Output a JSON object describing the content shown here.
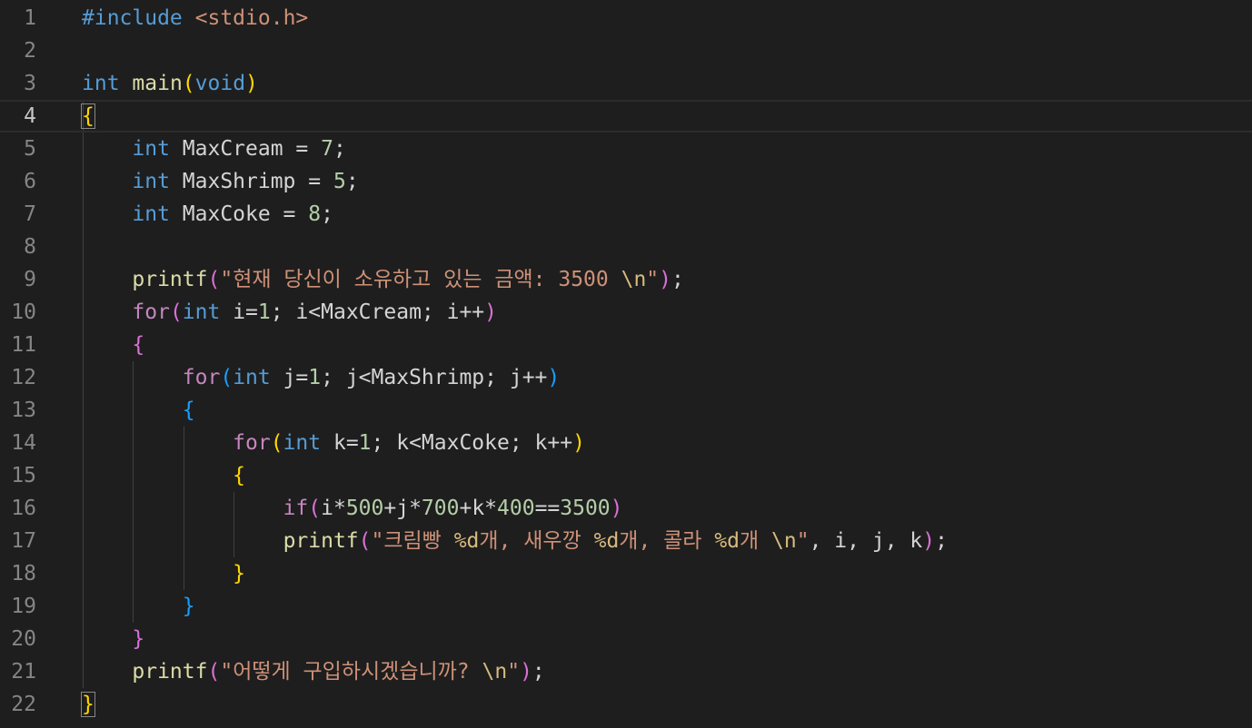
{
  "editor": {
    "language": "c",
    "theme_colors": {
      "background": "#1e1e1e",
      "keyword": "#569cd6",
      "control": "#c586c0",
      "function": "#dcdcaa",
      "string": "#ce9178",
      "number": "#b5cea8",
      "bracket_level1": "#ffd700",
      "bracket_level2": "#da70d6",
      "bracket_level3": "#179fff"
    },
    "active_line": 4,
    "lines": [
      {
        "num": "1",
        "tokens": [
          {
            "t": "#include",
            "c": "inc"
          },
          {
            "t": " ",
            "c": "plain"
          },
          {
            "t": "<stdio.h>",
            "c": "str"
          }
        ]
      },
      {
        "num": "2",
        "tokens": []
      },
      {
        "num": "3",
        "tokens": [
          {
            "t": "int",
            "c": "kw"
          },
          {
            "t": " ",
            "c": "plain"
          },
          {
            "t": "main",
            "c": "fn"
          },
          {
            "t": "(",
            "c": "b1"
          },
          {
            "t": "void",
            "c": "kw"
          },
          {
            "t": ")",
            "c": "b1"
          }
        ]
      },
      {
        "num": "4",
        "tokens": [
          {
            "t": "{",
            "c": "b1",
            "match": true
          }
        ]
      },
      {
        "num": "5",
        "tokens": [
          {
            "t": "    ",
            "c": "plain"
          },
          {
            "t": "int",
            "c": "kw"
          },
          {
            "t": " MaxCream = ",
            "c": "plain"
          },
          {
            "t": "7",
            "c": "num"
          },
          {
            "t": ";",
            "c": "plain"
          }
        ]
      },
      {
        "num": "6",
        "tokens": [
          {
            "t": "    ",
            "c": "plain"
          },
          {
            "t": "int",
            "c": "kw"
          },
          {
            "t": " MaxShrimp = ",
            "c": "plain"
          },
          {
            "t": "5",
            "c": "num"
          },
          {
            "t": ";",
            "c": "plain"
          }
        ]
      },
      {
        "num": "7",
        "tokens": [
          {
            "t": "    ",
            "c": "plain"
          },
          {
            "t": "int",
            "c": "kw"
          },
          {
            "t": " MaxCoke = ",
            "c": "plain"
          },
          {
            "t": "8",
            "c": "num"
          },
          {
            "t": ";",
            "c": "plain"
          }
        ]
      },
      {
        "num": "8",
        "tokens": []
      },
      {
        "num": "9",
        "tokens": [
          {
            "t": "    ",
            "c": "plain"
          },
          {
            "t": "printf",
            "c": "fn"
          },
          {
            "t": "(",
            "c": "b2"
          },
          {
            "t": "\"현재 당신이 소유하고 있는 금액: 3500 ",
            "c": "str"
          },
          {
            "t": "\\n",
            "c": "esc"
          },
          {
            "t": "\"",
            "c": "str"
          },
          {
            "t": ")",
            "c": "b2"
          },
          {
            "t": ";",
            "c": "plain"
          }
        ]
      },
      {
        "num": "10",
        "tokens": [
          {
            "t": "    ",
            "c": "plain"
          },
          {
            "t": "for",
            "c": "ctl"
          },
          {
            "t": "(",
            "c": "b2"
          },
          {
            "t": "int",
            "c": "kw"
          },
          {
            "t": " i=",
            "c": "plain"
          },
          {
            "t": "1",
            "c": "num"
          },
          {
            "t": "; i<MaxCream; i++",
            "c": "plain"
          },
          {
            "t": ")",
            "c": "b2"
          }
        ]
      },
      {
        "num": "11",
        "tokens": [
          {
            "t": "    ",
            "c": "plain"
          },
          {
            "t": "{",
            "c": "b2"
          }
        ]
      },
      {
        "num": "12",
        "tokens": [
          {
            "t": "        ",
            "c": "plain"
          },
          {
            "t": "for",
            "c": "ctl"
          },
          {
            "t": "(",
            "c": "b3"
          },
          {
            "t": "int",
            "c": "kw"
          },
          {
            "t": " j=",
            "c": "plain"
          },
          {
            "t": "1",
            "c": "num"
          },
          {
            "t": "; j<MaxShrimp; j++",
            "c": "plain"
          },
          {
            "t": ")",
            "c": "b3"
          }
        ]
      },
      {
        "num": "13",
        "tokens": [
          {
            "t": "        ",
            "c": "plain"
          },
          {
            "t": "{",
            "c": "b3"
          }
        ]
      },
      {
        "num": "14",
        "tokens": [
          {
            "t": "            ",
            "c": "plain"
          },
          {
            "t": "for",
            "c": "ctl"
          },
          {
            "t": "(",
            "c": "b1"
          },
          {
            "t": "int",
            "c": "kw"
          },
          {
            "t": " k=",
            "c": "plain"
          },
          {
            "t": "1",
            "c": "num"
          },
          {
            "t": "; k<MaxCoke; k++",
            "c": "plain"
          },
          {
            "t": ")",
            "c": "b1"
          }
        ]
      },
      {
        "num": "15",
        "tokens": [
          {
            "t": "            ",
            "c": "plain"
          },
          {
            "t": "{",
            "c": "b1"
          }
        ]
      },
      {
        "num": "16",
        "tokens": [
          {
            "t": "                ",
            "c": "plain"
          },
          {
            "t": "if",
            "c": "ctl"
          },
          {
            "t": "(",
            "c": "b2"
          },
          {
            "t": "i*",
            "c": "plain"
          },
          {
            "t": "500",
            "c": "num"
          },
          {
            "t": "+j*",
            "c": "plain"
          },
          {
            "t": "700",
            "c": "num"
          },
          {
            "t": "+k*",
            "c": "plain"
          },
          {
            "t": "400",
            "c": "num"
          },
          {
            "t": "==",
            "c": "plain"
          },
          {
            "t": "3500",
            "c": "num"
          },
          {
            "t": ")",
            "c": "b2"
          }
        ]
      },
      {
        "num": "17",
        "tokens": [
          {
            "t": "                ",
            "c": "plain"
          },
          {
            "t": "printf",
            "c": "fn"
          },
          {
            "t": "(",
            "c": "b2"
          },
          {
            "t": "\"크림빵 ",
            "c": "str"
          },
          {
            "t": "%d",
            "c": "esc"
          },
          {
            "t": "개, 새우깡 ",
            "c": "str"
          },
          {
            "t": "%d",
            "c": "esc"
          },
          {
            "t": "개, 콜라 ",
            "c": "str"
          },
          {
            "t": "%d",
            "c": "esc"
          },
          {
            "t": "개 ",
            "c": "str"
          },
          {
            "t": "\\n",
            "c": "esc"
          },
          {
            "t": "\"",
            "c": "str"
          },
          {
            "t": ", i, j, k",
            "c": "plain"
          },
          {
            "t": ")",
            "c": "b2"
          },
          {
            "t": ";",
            "c": "plain"
          }
        ]
      },
      {
        "num": "18",
        "tokens": [
          {
            "t": "            ",
            "c": "plain"
          },
          {
            "t": "}",
            "c": "b1"
          }
        ]
      },
      {
        "num": "19",
        "tokens": [
          {
            "t": "        ",
            "c": "plain"
          },
          {
            "t": "}",
            "c": "b3"
          }
        ]
      },
      {
        "num": "20",
        "tokens": [
          {
            "t": "    ",
            "c": "plain"
          },
          {
            "t": "}",
            "c": "b2"
          }
        ]
      },
      {
        "num": "21",
        "tokens": [
          {
            "t": "    ",
            "c": "plain"
          },
          {
            "t": "printf",
            "c": "fn"
          },
          {
            "t": "(",
            "c": "b2"
          },
          {
            "t": "\"어떻게 구입하시겠습니까? ",
            "c": "str"
          },
          {
            "t": "\\n",
            "c": "esc"
          },
          {
            "t": "\"",
            "c": "str"
          },
          {
            "t": ")",
            "c": "b2"
          },
          {
            "t": ";",
            "c": "plain"
          }
        ]
      },
      {
        "num": "22",
        "tokens": [
          {
            "t": "}",
            "c": "b1",
            "match": true
          }
        ]
      }
    ]
  }
}
